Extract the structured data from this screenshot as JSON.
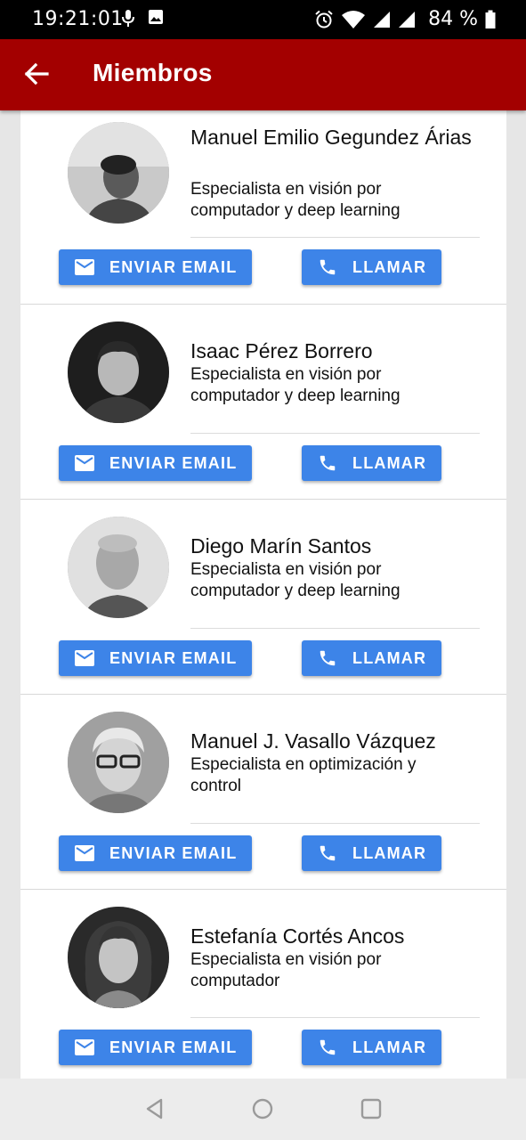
{
  "status_bar": {
    "time": "19:21:01",
    "battery_percent": "84 %",
    "icons": [
      "mic-icon",
      "image-icon",
      "alarm-icon",
      "wifi-icon",
      "signal-icon",
      "signal-icon",
      "battery-icon"
    ]
  },
  "app_bar": {
    "title": "Miembros",
    "back_icon": "arrow-left-icon",
    "color": "#a30000"
  },
  "members": [
    {
      "name": "Manuel Emilio Gegundez Árias",
      "role": "Especialista en visión por computador y deep learning",
      "email_label": "ENVIAR EMAIL",
      "call_label": "LLAMAR"
    },
    {
      "name": "Isaac Pérez Borrero",
      "role": "Especialista en visión por computador y deep learning",
      "email_label": "ENVIAR EMAIL",
      "call_label": "LLAMAR"
    },
    {
      "name": "Diego Marín Santos",
      "role": "Especialista en visión por computador y deep learning",
      "email_label": "ENVIAR EMAIL",
      "call_label": "LLAMAR"
    },
    {
      "name": "Manuel J. Vasallo Vázquez",
      "role": "Especialista en optimización y control",
      "email_label": "ENVIAR EMAIL",
      "call_label": "LLAMAR"
    },
    {
      "name": "Estefanía Cortés Ancos",
      "role": "Especialista en visión por computador",
      "email_label": "ENVIAR EMAIL",
      "call_label": "LLAMAR"
    }
  ],
  "button_color": "#3d84e8",
  "nav_bar": {
    "icons": [
      "back-triangle-icon",
      "home-circle-icon",
      "recents-square-icon"
    ]
  }
}
